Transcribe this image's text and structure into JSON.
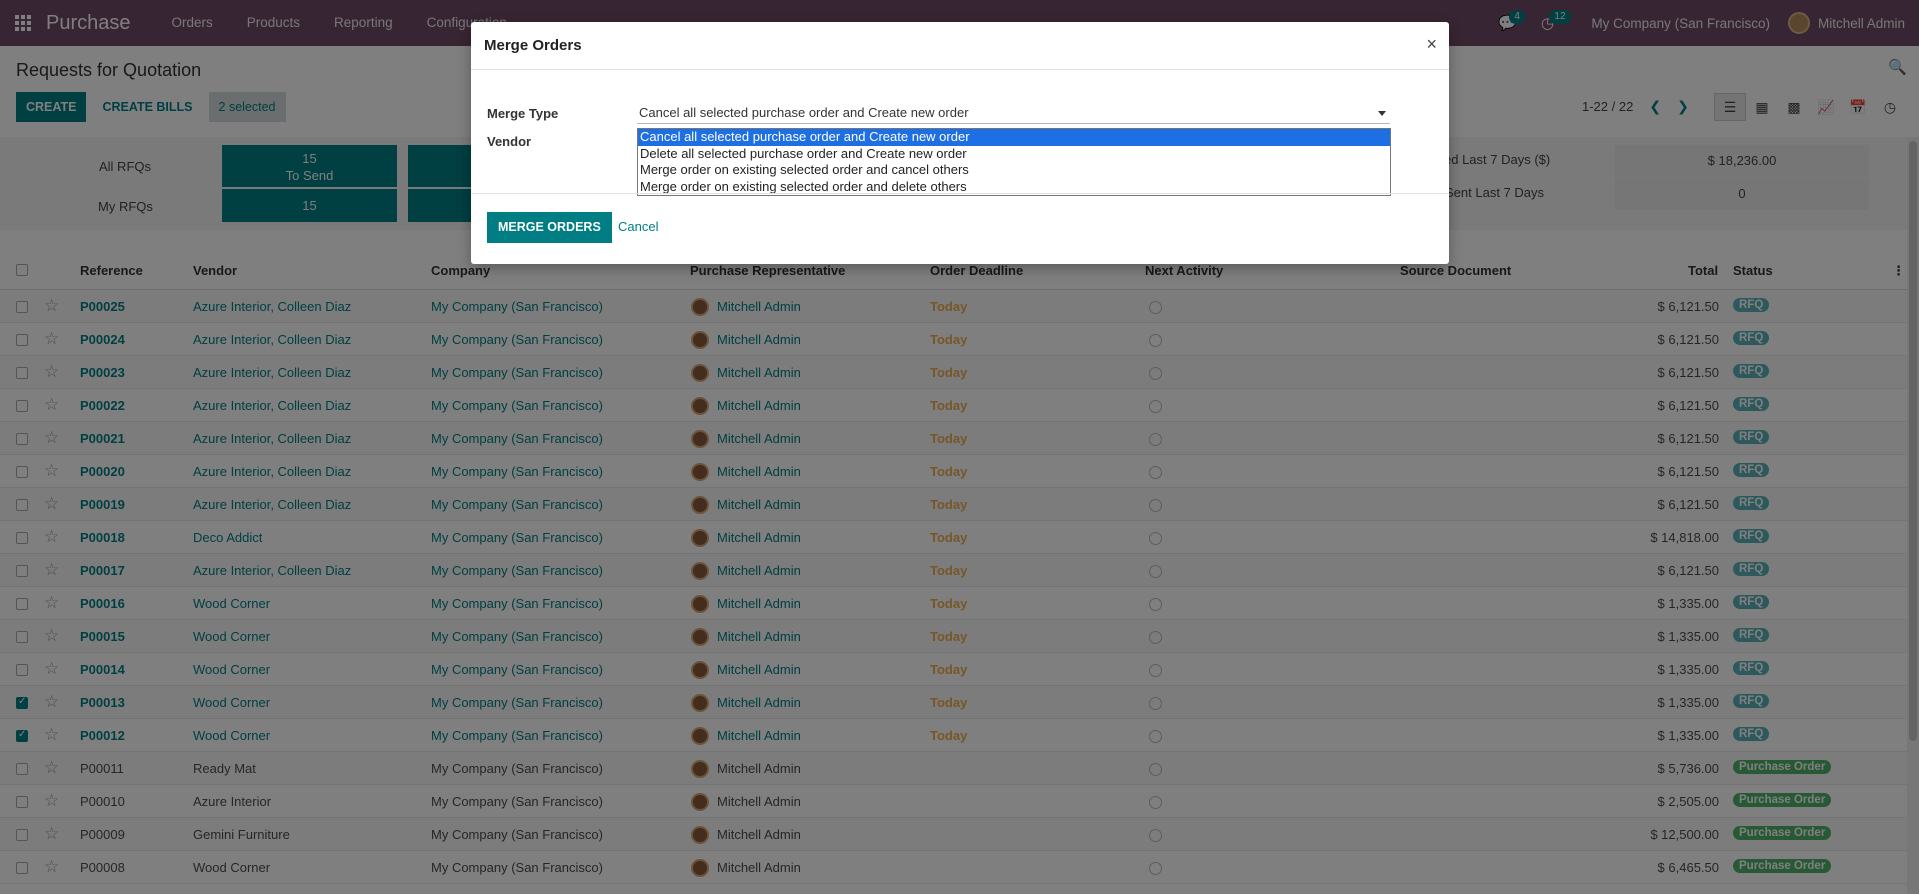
{
  "navbar": {
    "brand": "Purchase",
    "menu": [
      "Orders",
      "Products",
      "Reporting",
      "Configuration"
    ],
    "chat_badge": "4",
    "activity_badge": "12",
    "company": "My Company (San Francisco)",
    "user": "Mitchell Admin"
  },
  "control_panel": {
    "title": "Requests for Quotation",
    "create": "CREATE",
    "create_bills": "CREATE BILLS",
    "selected": "2 selected",
    "pager": "1-22 / 22"
  },
  "dashboard": {
    "all_rfqs": "All RFQs",
    "my_rfqs": "My RFQs",
    "to_send_count": "15",
    "to_send_label": "To Send",
    "my_to_send_count": "15",
    "kpi1_label": "ed Last 7 Days ($)",
    "kpi1_value": "$ 18,236.00",
    "kpi2_label": "Sent Last 7 Days",
    "kpi2_value": "0"
  },
  "table": {
    "headers": {
      "reference": "Reference",
      "vendor": "Vendor",
      "company": "Company",
      "rep": "Purchase Representative",
      "deadline": "Order Deadline",
      "activity": "Next Activity",
      "source": "Source Document",
      "total": "Total",
      "status": "Status"
    },
    "rows": [
      {
        "ref": "P00025",
        "vendor": "Azure Interior, Colleen Diaz",
        "company": "My Company (San Francisco)",
        "rep": "Mitchell Admin",
        "deadline": "Today",
        "total": "$ 6,121.50",
        "status": "RFQ",
        "checked": false
      },
      {
        "ref": "P00024",
        "vendor": "Azure Interior, Colleen Diaz",
        "company": "My Company (San Francisco)",
        "rep": "Mitchell Admin",
        "deadline": "Today",
        "total": "$ 6,121.50",
        "status": "RFQ",
        "checked": false
      },
      {
        "ref": "P00023",
        "vendor": "Azure Interior, Colleen Diaz",
        "company": "My Company (San Francisco)",
        "rep": "Mitchell Admin",
        "deadline": "Today",
        "total": "$ 6,121.50",
        "status": "RFQ",
        "checked": false
      },
      {
        "ref": "P00022",
        "vendor": "Azure Interior, Colleen Diaz",
        "company": "My Company (San Francisco)",
        "rep": "Mitchell Admin",
        "deadline": "Today",
        "total": "$ 6,121.50",
        "status": "RFQ",
        "checked": false
      },
      {
        "ref": "P00021",
        "vendor": "Azure Interior, Colleen Diaz",
        "company": "My Company (San Francisco)",
        "rep": "Mitchell Admin",
        "deadline": "Today",
        "total": "$ 6,121.50",
        "status": "RFQ",
        "checked": false
      },
      {
        "ref": "P00020",
        "vendor": "Azure Interior, Colleen Diaz",
        "company": "My Company (San Francisco)",
        "rep": "Mitchell Admin",
        "deadline": "Today",
        "total": "$ 6,121.50",
        "status": "RFQ",
        "checked": false
      },
      {
        "ref": "P00019",
        "vendor": "Azure Interior, Colleen Diaz",
        "company": "My Company (San Francisco)",
        "rep": "Mitchell Admin",
        "deadline": "Today",
        "total": "$ 6,121.50",
        "status": "RFQ",
        "checked": false
      },
      {
        "ref": "P00018",
        "vendor": "Deco Addict",
        "company": "My Company (San Francisco)",
        "rep": "Mitchell Admin",
        "deadline": "Today",
        "total": "$ 14,818.00",
        "status": "RFQ",
        "checked": false
      },
      {
        "ref": "P00017",
        "vendor": "Azure Interior, Colleen Diaz",
        "company": "My Company (San Francisco)",
        "rep": "Mitchell Admin",
        "deadline": "Today",
        "total": "$ 6,121.50",
        "status": "RFQ",
        "checked": false
      },
      {
        "ref": "P00016",
        "vendor": "Wood Corner",
        "company": "My Company (San Francisco)",
        "rep": "Mitchell Admin",
        "deadline": "Today",
        "total": "$ 1,335.00",
        "status": "RFQ",
        "checked": false
      },
      {
        "ref": "P00015",
        "vendor": "Wood Corner",
        "company": "My Company (San Francisco)",
        "rep": "Mitchell Admin",
        "deadline": "Today",
        "total": "$ 1,335.00",
        "status": "RFQ",
        "checked": false
      },
      {
        "ref": "P00014",
        "vendor": "Wood Corner",
        "company": "My Company (San Francisco)",
        "rep": "Mitchell Admin",
        "deadline": "Today",
        "total": "$ 1,335.00",
        "status": "RFQ",
        "checked": false
      },
      {
        "ref": "P00013",
        "vendor": "Wood Corner",
        "company": "My Company (San Francisco)",
        "rep": "Mitchell Admin",
        "deadline": "Today",
        "total": "$ 1,335.00",
        "status": "RFQ",
        "checked": true
      },
      {
        "ref": "P00012",
        "vendor": "Wood Corner",
        "company": "My Company (San Francisco)",
        "rep": "Mitchell Admin",
        "deadline": "Today",
        "total": "$ 1,335.00",
        "status": "RFQ",
        "checked": true
      },
      {
        "ref": "P00011",
        "vendor": "Ready Mat",
        "company": "My Company (San Francisco)",
        "rep": "Mitchell Admin",
        "deadline": "",
        "total": "$ 5,736.00",
        "status": "Purchase Order",
        "checked": false
      },
      {
        "ref": "P00010",
        "vendor": "Azure Interior",
        "company": "My Company (San Francisco)",
        "rep": "Mitchell Admin",
        "deadline": "",
        "total": "$ 2,505.00",
        "status": "Purchase Order",
        "checked": false
      },
      {
        "ref": "P00009",
        "vendor": "Gemini Furniture",
        "company": "My Company (San Francisco)",
        "rep": "Mitchell Admin",
        "deadline": "",
        "total": "$ 12,500.00",
        "status": "Purchase Order",
        "checked": false
      },
      {
        "ref": "P00008",
        "vendor": "Wood Corner",
        "company": "My Company (San Francisco)",
        "rep": "Mitchell Admin",
        "deadline": "",
        "total": "$ 6,465.50",
        "status": "Purchase Order",
        "checked": false
      }
    ]
  },
  "modal": {
    "title": "Merge Orders",
    "merge_type_label": "Merge Type",
    "vendor_label": "Vendor",
    "selected_option": "Cancel all selected purchase order and Create new order",
    "options": [
      "Cancel all selected purchase order and Create new order",
      "Delete all selected purchase order and Create new order",
      "Merge order on existing selected order and cancel others",
      "Merge order on existing selected order and delete others"
    ],
    "merge_button": "MERGE ORDERS",
    "cancel_button": "Cancel"
  },
  "colors": {
    "navbar": "#714b67",
    "primary": "#017e84",
    "deadline": "#f0ad4e",
    "rfq_badge": "#5ab3b8",
    "po_badge": "#4fb36b",
    "option_highlight": "#1e6fe3"
  }
}
